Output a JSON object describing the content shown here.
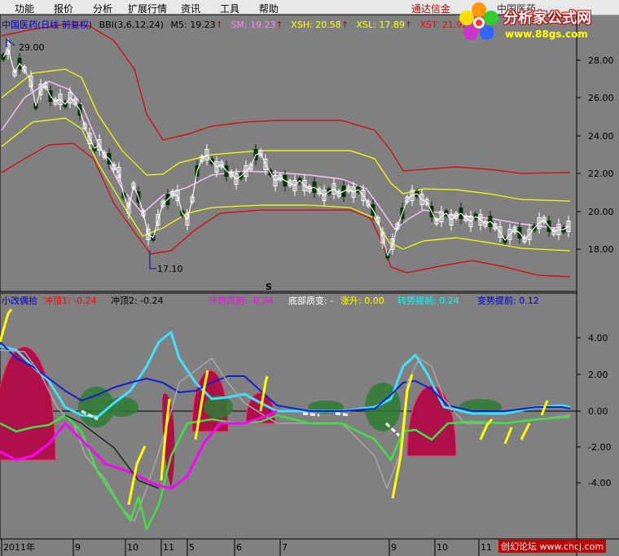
{
  "menu": {
    "items": [
      "功能",
      "报价",
      "分析",
      "扩展行情",
      "资讯",
      "工具",
      "帮助"
    ],
    "right_text": "通达信金",
    "right_text2": "中国医药"
  },
  "logo": {
    "title": "分析家公式网",
    "url": "www.88gs.com"
  },
  "price_panel": {
    "stock_title": "中国医药(日线 前复权)",
    "indicator": "BBI(3,6,12,24)",
    "m5": "M5: 19.23",
    "sm": "SM: 19.23",
    "xsh": "XSH: 20.58",
    "xsl": "XSL: 17.89",
    "xst": "XST: 21.92",
    "high_marker": "29.00",
    "low_marker": "17.10",
    "signal_marker": "S",
    "y_ticks": [
      "28.00",
      "26.00",
      "24.00",
      "22.00",
      "20.00",
      "18.00"
    ]
  },
  "indicator_panel": {
    "name": "小改偶拾",
    "items": [
      {
        "label": "冲顶1: -0.24",
        "color": "#ff0000"
      },
      {
        "label": "冲顶2: -0.24",
        "color": "#000000"
      },
      {
        "label": "升势周期: -0.24",
        "color": "#ff00ff"
      },
      {
        "label": "底部质变: -",
        "color": "#ffffff"
      },
      {
        "label": "涨升: 0.00",
        "color": "#ffff00"
      },
      {
        "label": "转势提前: 0.24",
        "color": "#00ffff"
      },
      {
        "label": "变势提前: 0.12",
        "color": "#0000cc"
      }
    ],
    "y_ticks": [
      "4.00",
      "2.00",
      "0.00",
      "-2.00",
      "-4.00"
    ]
  },
  "x_axis": {
    "labels": [
      "2011年",
      "9",
      "10",
      "11",
      "5",
      "6",
      "7",
      "9",
      "10",
      "11"
    ]
  },
  "footer": {
    "watermark": "创幻论坛 www.chcj.com"
  }
}
